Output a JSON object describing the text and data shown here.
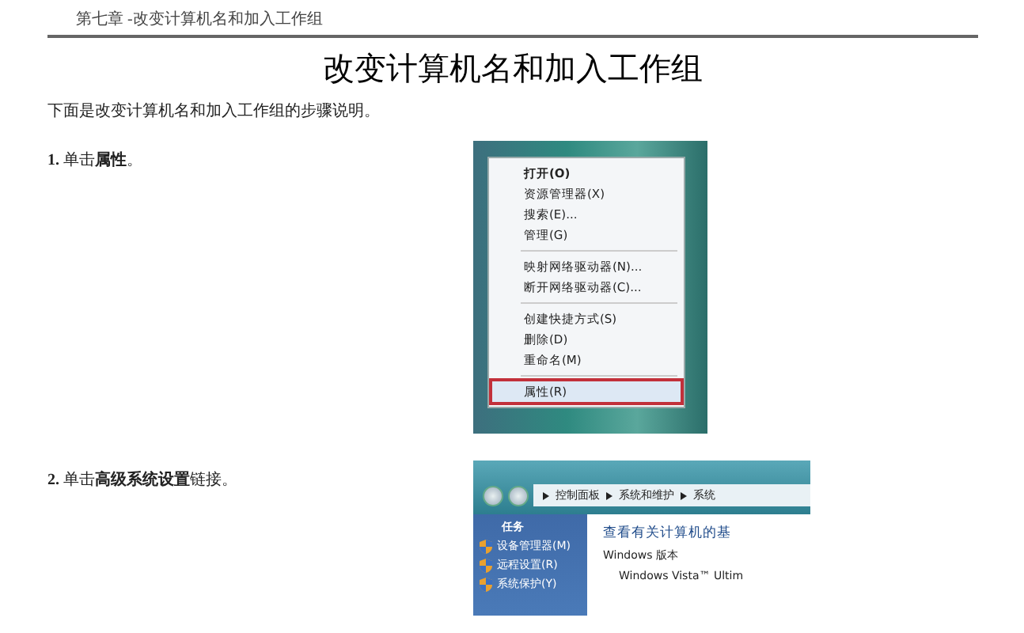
{
  "header": {
    "chapter": "第七章 -改变计算机名和加入工作组"
  },
  "title": "改变计算机名和加入工作组",
  "intro": "下面是改变计算机名和加入工作组的步骤说明。",
  "steps": [
    {
      "number": "1.",
      "text": "单击**属性**。",
      "screenshot": {
        "kind": "context_menu",
        "groups": [
          {
            "items": [
              {
                "label": "打开(O)",
                "default": true,
                "selected": false
              },
              {
                "label": "资源管理器(X)",
                "default": false,
                "selected": false
              },
              {
                "label": "搜索(E)...",
                "default": false,
                "selected": false
              },
              {
                "label": "管理(G)",
                "default": false,
                "selected": false
              }
            ]
          },
          {
            "items": [
              {
                "label": "映射网络驱动器(N)...",
                "default": false,
                "selected": false
              },
              {
                "label": "断开网络驱动器(C)...",
                "default": false,
                "selected": false
              }
            ]
          },
          {
            "items": [
              {
                "label": "创建快捷方式(S)",
                "default": false,
                "selected": false
              },
              {
                "label": "删除(D)",
                "default": false,
                "selected": false
              },
              {
                "label": "重命名(M)",
                "default": false,
                "selected": false
              }
            ]
          },
          {
            "items": [
              {
                "label": "属性(R)",
                "default": false,
                "selected": true
              }
            ]
          }
        ]
      }
    },
    {
      "number": "2.",
      "text": "单击**高级系统设置**链接。",
      "screenshot": {
        "kind": "control_panel",
        "breadcrumb": [
          "控制面板",
          "系统和维护",
          "系统"
        ],
        "tasks_heading": "任务",
        "tasks": [
          "设备管理器(M)",
          "远程设置(R)",
          "系统保护(Y)"
        ],
        "heading": "查看有关计算机的基",
        "section": "Windows 版本",
        "edition": "Windows Vista™ Ultim"
      }
    }
  ]
}
